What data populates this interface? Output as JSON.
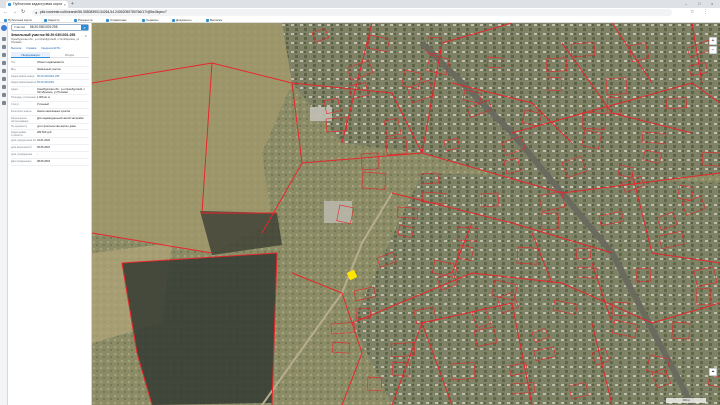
{
  "browser": {
    "tab_title": "Публичная кадастровая карта",
    "url": "pkk.rosreestr.ru/#/search/56.05508390134264,54.24052050780766/17/@5w3tqxnc7",
    "bookmarks": [
      "Публичная карта",
      "Кадастр",
      "Росреестр",
      "Справочник",
      "Сервисы",
      "Документы",
      "Выписка"
    ]
  },
  "panel": {
    "search_type": "Участки",
    "search_value": "56:20:0301001:295",
    "object_title": "Земельный участок 56:20:0301001:295",
    "object_subtitle": "Оренбургская обл., р-н Оренбургский, с Октябрьское, ул Полевая",
    "links": [
      "Выписка",
      "Справка",
      "Сведения ЕГРН"
    ],
    "tabs": [
      "Информация",
      "Услуги"
    ],
    "rows": [
      {
        "label": "Тип",
        "value": "Объект недвижимости"
      },
      {
        "label": "Вид",
        "value": "Земельный участок"
      },
      {
        "label": "Кадастровый номер",
        "value": "56:20:0301001:295",
        "link": true
      },
      {
        "label": "Кадастровый квартал",
        "value": "56:20:0301001",
        "link": true
      },
      {
        "label": "Адрес",
        "value": "Оренбургская обл., р-н Оренбургский, с Октябрьское, ул Полевая"
      },
      {
        "label": "Площадь уточненная",
        "value": "1 000 кв. м"
      },
      {
        "label": "Статус",
        "value": "Учтенный"
      },
      {
        "label": "Категория земель",
        "value": "Земли населённых пунктов"
      },
      {
        "label": "Разрешенное использование",
        "value": "Для индивидуальной жилой застройки"
      },
      {
        "label": "По документу",
        "value": "для строительства жилого дома"
      },
      {
        "label": "Кадастровая стоимость",
        "value": "283 500 руб."
      },
      {
        "label": "дата определения КС",
        "value": "01.01.2022"
      },
      {
        "label": "дата внесения КС",
        "value": "05.05.2018"
      },
      {
        "label": "дата утверждения",
        "value": "-"
      },
      {
        "label": "Дата применения",
        "value": "08.05.2018"
      }
    ]
  },
  "map": {
    "controls": [
      "+",
      "−",
      "⌖"
    ],
    "scale_label": "200 м",
    "highlight_color": "#ffe600",
    "boundary_color": "#e8262b"
  },
  "icons": [
    "app-logo-icon",
    "layers-icon",
    "measure-icon",
    "print-icon",
    "search-icon",
    "close-icon",
    "zoom-in-icon",
    "zoom-out-icon",
    "locate-icon"
  ]
}
